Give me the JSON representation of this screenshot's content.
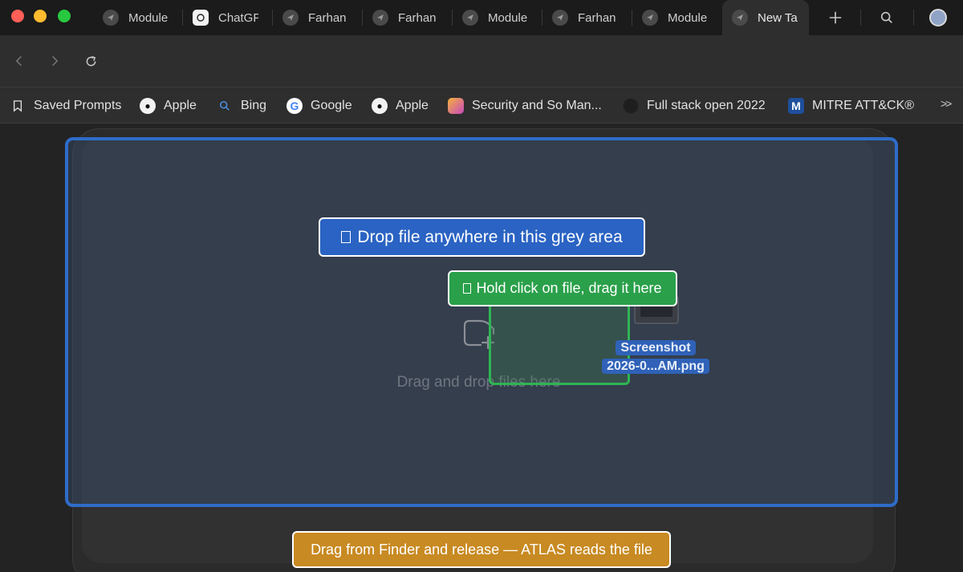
{
  "tabs": [
    {
      "label": "Module",
      "icon": "module-icon",
      "active": false
    },
    {
      "label": "ChatGPT",
      "icon": "chatgpt-icon",
      "active": false
    },
    {
      "label": "Farhan",
      "icon": "module-icon",
      "active": false
    },
    {
      "label": "Farhan",
      "icon": "module-icon",
      "active": false
    },
    {
      "label": "Module",
      "icon": "module-icon",
      "active": false
    },
    {
      "label": "Farhan",
      "icon": "module-icon",
      "active": false
    },
    {
      "label": "Module",
      "icon": "module-icon",
      "active": false
    },
    {
      "label": "New Tab",
      "icon": "module-icon",
      "active": true
    }
  ],
  "bookmarks": [
    {
      "label": "Saved Prompts",
      "icon": "bookmark-icon"
    },
    {
      "label": "Apple",
      "icon": "apple-icon"
    },
    {
      "label": "Bing",
      "icon": "search-icon"
    },
    {
      "label": "Google",
      "icon": "google-icon"
    },
    {
      "label": "Apple",
      "icon": "apple-icon"
    },
    {
      "label": "Security and So Man...",
      "icon": "security-icon"
    },
    {
      "label": "Full stack open 2022",
      "icon": "fullstack-icon"
    },
    {
      "label": "MITRE ATT&CK®",
      "icon": "mitre-icon"
    }
  ],
  "bookmarks_more": ">>",
  "drop_zone": {
    "hint": "Drag and drop files here"
  },
  "dragged_file": {
    "line1": "Screenshot",
    "line2": "2026-0...AM.png"
  },
  "callouts": {
    "drop_anywhere": "Drop file anywhere in this grey area",
    "hold_click": "Hold click on file, drag it here",
    "finder": "Drag from Finder and release — ATLAS reads the file"
  },
  "colors": {
    "drop_border": "#2f6cc9",
    "callout_blue": "#2a63c3",
    "callout_green": "#2aa04a",
    "callout_orange": "#c88a22"
  }
}
